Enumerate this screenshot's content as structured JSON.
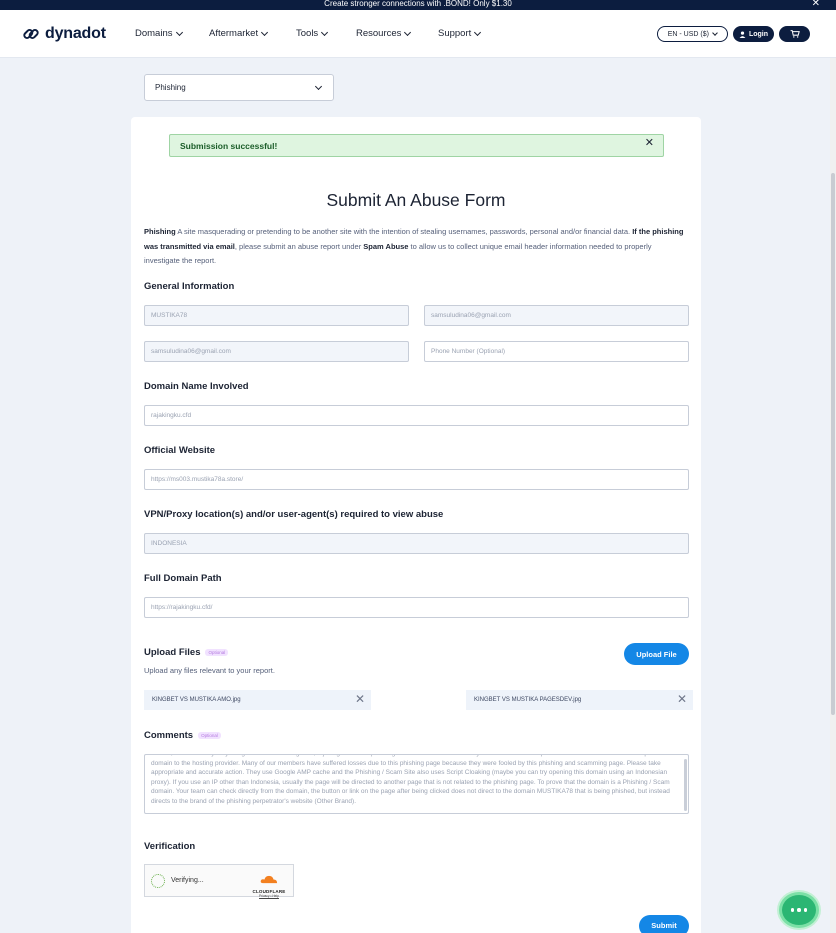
{
  "promo": {
    "text": "Create stronger connections with .BOND! Only $1.30",
    "close": "✕"
  },
  "nav": {
    "logo_text": "dynadot",
    "menu": [
      {
        "label": "Domains"
      },
      {
        "label": "Aftermarket"
      },
      {
        "label": "Tools"
      },
      {
        "label": "Resources"
      },
      {
        "label": "Support"
      }
    ],
    "lang_label": "EN - USD ($)",
    "login_label": "Login"
  },
  "abuse_type": {
    "selected": "Phishing"
  },
  "alert": {
    "text": "Submission successful!",
    "close": "✕"
  },
  "form": {
    "title": "Submit An Abuse Form",
    "desc": {
      "term": "Phishing",
      "definition": " A site masquerading or pretending to be another site with the intention of stealing usernames, passwords, personal and/or financial data. ",
      "condition": "If the phishing was transmitted via email",
      "mid": ", please submit an abuse report under ",
      "link": "Spam Abuse",
      "end": " to allow us to collect unique email header information needed to properly investigate the report."
    },
    "general_label": "General Information",
    "name_value": "MUSTIKA78",
    "email_value": "samsuludina06@gmail.com",
    "confirm_email_value": "samsuludina06@gmail.com",
    "phone_placeholder": "Phone Number (Optional)",
    "domain_label": "Domain Name Involved",
    "domain_value": "rajakingku.cfd",
    "website_label": "Official Website",
    "website_value": "https://ms003.mustika78a.store/",
    "vpn_label": "VPN/Proxy location(s) and/or user-agent(s) required to view abuse",
    "vpn_value": "INDONESIA",
    "path_label": "Full Domain Path",
    "path_value": "https://rajakingku.cfd/",
    "upload_label": "Upload Files",
    "optional_tag": "Optional",
    "upload_sub": "Upload any files relevant to your report.",
    "upload_button": "Upload File",
    "files": [
      {
        "name": "KINGBET VS MUSTIKA AMO.jpg",
        "remove": "✕"
      },
      {
        "name": "KINGBET VS MUSTIKA PAGESDEV.jpg",
        "remove": "✕"
      }
    ],
    "comments_label": "Comments",
    "comments_text": "brands, were certainly very dangerous. Our investigation, rajakingku.cfd is a phishing domain that uses the identity of our brand without permission. We have also tried to report this domain to the hosting provider. Many of our members have suffered losses due to this phishing page because they were fooled by this phishing and scamming page. Please take appropriate and accurate action. They use Google AMP cache and the Phishing / Scam Site also uses Script Cloaking (maybe you can try opening this domain using an Indonesian proxy). If you use an IP other than Indonesia, usually the page will be directed to another page that is not related to the phishing page. To prove that the domain is a Phishing / Scam domain. Your team can check directly from the domain, the button or link on the page after being clicked does not direct to the domain MUSTIKA78 that is being phished, but instead directs to the brand of the phishing perpetrator's website (Other Brand).",
    "verification_label": "Verification",
    "captcha_text": "Verifying...",
    "captcha_brand": "CLOUDFLARE",
    "captcha_links": "Privacy • Help",
    "submit_label": "Submit"
  }
}
